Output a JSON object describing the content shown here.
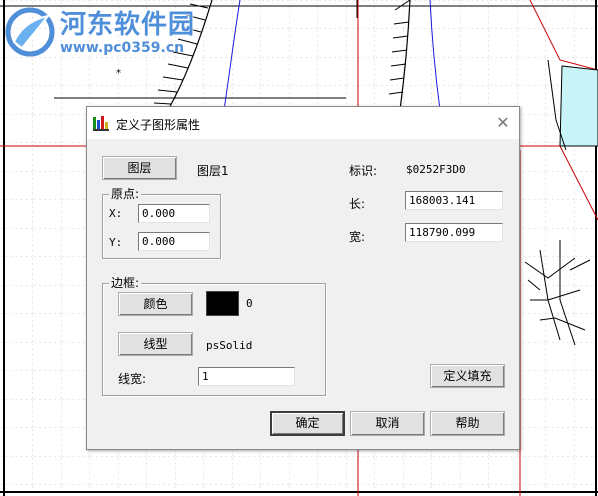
{
  "watermark": {
    "title": "河东软件园",
    "url": "www.pc0359.cn"
  },
  "dialog": {
    "title": "定义子图形属性",
    "close_symbol": "✕",
    "layer_button": "图层",
    "layer_value": "图层1",
    "origin": {
      "group_label": "原点:",
      "x_label": "X:",
      "x_value": "0.000",
      "y_label": "Y:",
      "y_value": "0.000"
    },
    "info": {
      "id_label": "标识:",
      "id_value": "$0252F3D0",
      "length_label": "长:",
      "length_value": "168003.141",
      "width_label": "宽:",
      "width_value": "118790.099"
    },
    "border": {
      "group_label": "边框:",
      "color_button": "颜色",
      "color_value": "0",
      "color_hex": "#000000",
      "linetype_button": "线型",
      "linetype_value": "psSolid",
      "linewidth_label": "线宽:",
      "linewidth_value": "1"
    },
    "buttons": {
      "define_fill": "定义填充",
      "ok": "确定",
      "cancel": "取消",
      "help": "帮助"
    }
  }
}
